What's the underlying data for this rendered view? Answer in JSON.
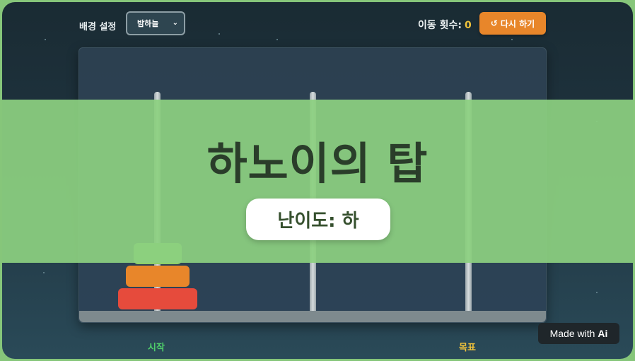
{
  "header": {
    "background_label": "배경 설정",
    "background_select_value": "밤하늘",
    "moves_label": "이동 횟수:",
    "moves_count": "0",
    "restart_label": "다시 하기",
    "restart_icon": "refresh-icon"
  },
  "overlay": {
    "title": "하노이의 탑",
    "difficulty": "난이도: 하"
  },
  "pegs": {
    "start_label": "시작",
    "goal_label": "목표"
  },
  "disks": [
    {
      "size": "large",
      "color": "#e64b3c"
    },
    {
      "size": "medium",
      "color": "#e8862a"
    },
    {
      "size": "small",
      "color": "#8fd067"
    }
  ],
  "badge": {
    "text": "Made with",
    "ai": "Ai"
  },
  "colors": {
    "accent_orange": "#e8862a",
    "moves_count": "#f0c23b",
    "start_label": "#4fce6a",
    "goal_label": "#f0c23b",
    "overlay_green": "#8cd080"
  }
}
